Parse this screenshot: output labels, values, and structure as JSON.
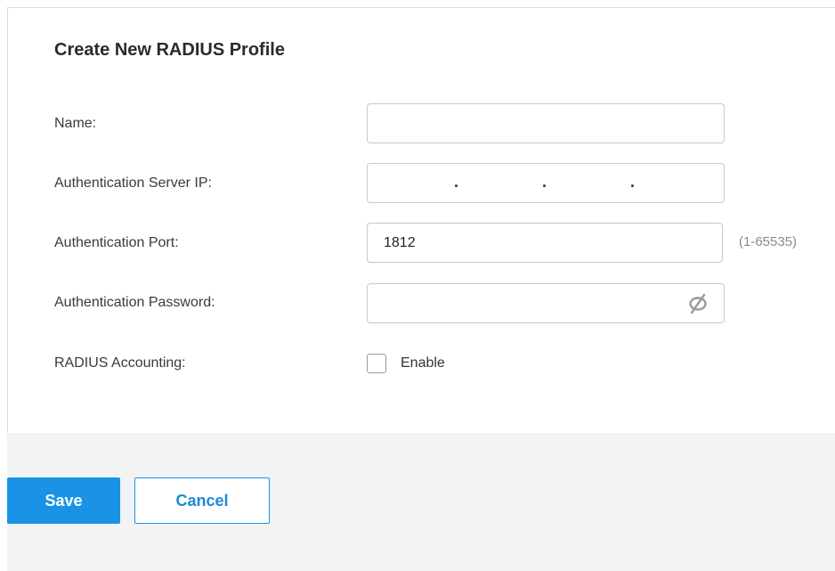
{
  "dialog": {
    "title": "Create New RADIUS Profile"
  },
  "form": {
    "name": {
      "label": "Name:",
      "value": ""
    },
    "auth_server_ip": {
      "label": "Authentication Server IP:",
      "octets": [
        "",
        "",
        "",
        ""
      ],
      "separator": "."
    },
    "auth_port": {
      "label": "Authentication Port:",
      "value": "1812",
      "hint": "(1-65535)"
    },
    "auth_password": {
      "label": "Authentication Password:",
      "value": "",
      "icon": "eye-slash-icon"
    },
    "radius_accounting": {
      "label": "RADIUS Accounting:",
      "checkbox_label": "Enable",
      "checked": false
    }
  },
  "footer": {
    "save_label": "Save",
    "cancel_label": "Cancel"
  },
  "colors": {
    "primary": "#1a93e6",
    "footer_bg": "#f2f3f5",
    "hint": "#8a8a8a"
  }
}
